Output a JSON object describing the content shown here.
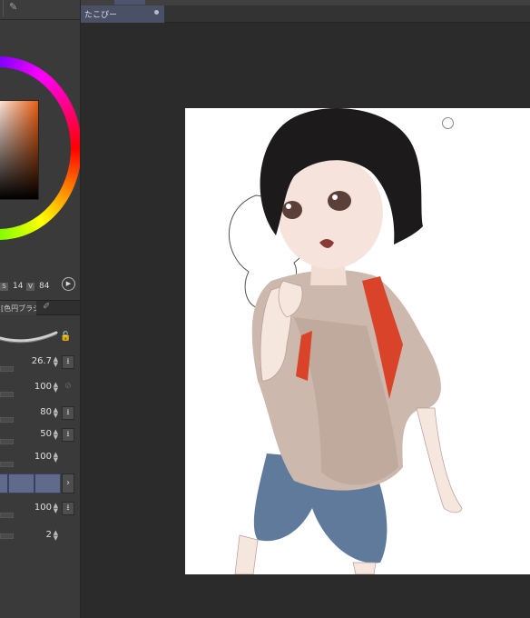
{
  "left_panel": {
    "top_icon": "pen-nib-icon",
    "hsv": {
      "s_label": "S",
      "s_value": "14",
      "v_label": "V",
      "v_value": "84"
    },
    "tool_tab_label": "[色円ブラシ]",
    "params": [
      {
        "value": "26.7"
      },
      {
        "value": "100"
      },
      {
        "value": "80"
      },
      {
        "value": "50"
      },
      {
        "value": "100"
      },
      {
        "value": "100"
      },
      {
        "value": "2"
      }
    ]
  },
  "document": {
    "tab_title": "たこぴー"
  },
  "colors": {
    "accent": "#e85e14",
    "tab_active": "#4a5066",
    "preset_cell": "#5f6a8c"
  }
}
